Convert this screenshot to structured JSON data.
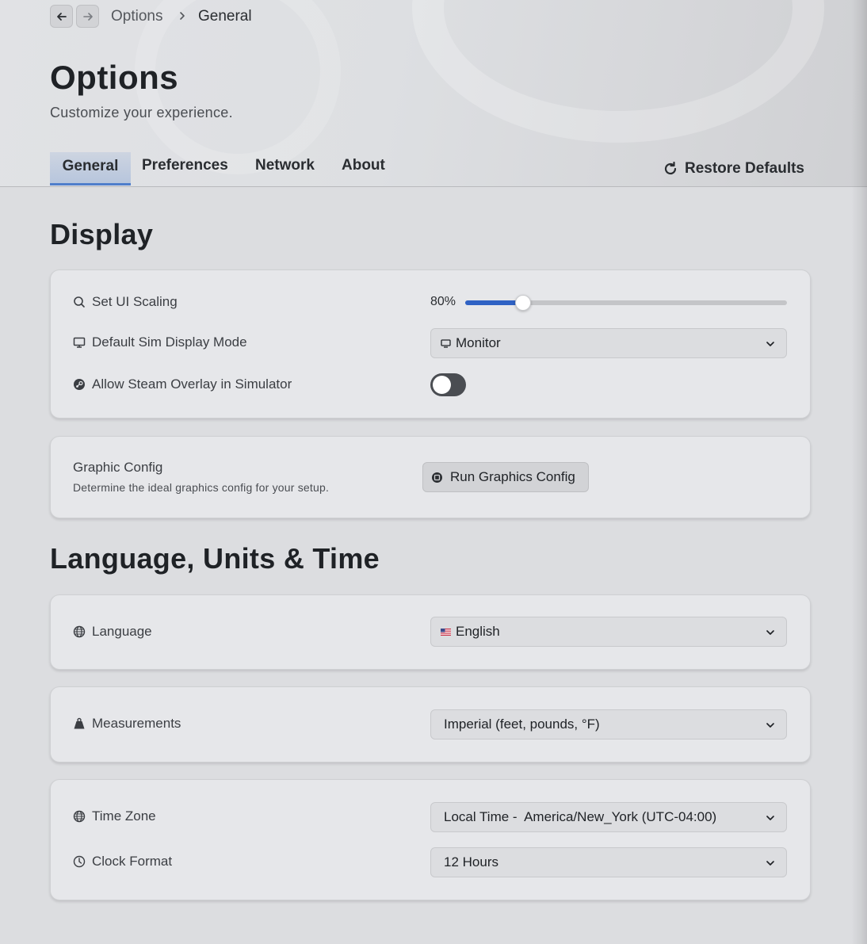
{
  "breadcrumb": {
    "parent": "Options",
    "current": "General"
  },
  "page": {
    "title": "Options",
    "subtitle": "Customize your experience."
  },
  "tabs": [
    {
      "label": "General",
      "active": true
    },
    {
      "label": "Preferences",
      "active": false
    },
    {
      "label": "Network",
      "active": false
    },
    {
      "label": "About",
      "active": false
    }
  ],
  "restore_label": "Restore Defaults",
  "display": {
    "title": "Display",
    "ui_scaling": {
      "label": "Set UI Scaling",
      "value_text": "80%",
      "fraction": 0.18,
      "icon": "search-icon"
    },
    "sim_display_mode": {
      "label": "Default Sim Display Mode",
      "value": "Monitor",
      "icon": "monitor-icon"
    },
    "steam_overlay": {
      "label": "Allow Steam Overlay in Simulator",
      "enabled": false,
      "icon": "steam-icon"
    }
  },
  "graphics": {
    "title": "Graphic Config",
    "description": "Determine the ideal graphics config for your setup.",
    "button_label": "Run Graphics Config"
  },
  "language_section": {
    "title": "Language, Units & Time",
    "language": {
      "label": "Language",
      "value": "English",
      "icon": "globe-icon"
    },
    "measurements": {
      "label": "Measurements",
      "value": "Imperial (feet, pounds, °F)",
      "icon": "weight-icon"
    },
    "time_zone": {
      "label": "Time Zone",
      "value": "Local Time -  America/New_York (UTC-04:00)",
      "icon": "globe-icon"
    },
    "clock_format": {
      "label": "Clock Format",
      "value": "12 Hours",
      "icon": "clock-icon"
    }
  },
  "colors": {
    "accent": "#2f62c4",
    "tab_underline": "#4f7ecb",
    "toggle_off": "#4a4d52"
  }
}
